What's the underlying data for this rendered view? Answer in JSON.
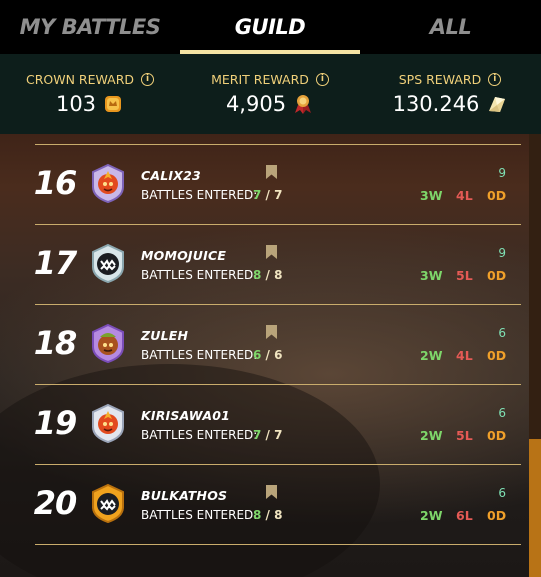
{
  "tabs": [
    {
      "label": "MY BATTLES",
      "active": false
    },
    {
      "label": "GUILD",
      "active": true
    },
    {
      "label": "ALL",
      "active": false
    }
  ],
  "rewards": [
    {
      "label": "CROWN REWARD",
      "value": "103",
      "icon": "crown-token-icon",
      "info_icon": "info-icon"
    },
    {
      "label": "MERIT REWARD",
      "value": "4,905",
      "icon": "merit-badge-icon",
      "info_icon": "info-icon"
    },
    {
      "label": "SPS REWARD",
      "value": "130.246",
      "icon": "sps-crystal-icon",
      "info_icon": "info-icon"
    }
  ],
  "colors": {
    "accent_gold": "#f0d07a",
    "tab_underline": "#f5e3a4",
    "wins": "#7ed66a",
    "losses": "#e55a55",
    "draws": "#f0a02a",
    "score": "#7fe0b4",
    "scrollbar_thumb": "#b87316"
  },
  "battles_entered_label": "BATTLES ENTERED:",
  "players": [
    {
      "rank": "16",
      "name": "CALIX23",
      "entered": "7",
      "total": "7",
      "score": "9",
      "wins": "3W",
      "losses": "4L",
      "draws": "0D",
      "avatar": "fire-league-avatar-icon"
    },
    {
      "rank": "17",
      "name": "MOMOJUICE",
      "entered": "8",
      "total": "8",
      "score": "9",
      "wins": "3W",
      "losses": "5L",
      "draws": "0D",
      "avatar": "silver-monster-avatar-icon"
    },
    {
      "rank": "18",
      "name": "ZULEH",
      "entered": "6",
      "total": "6",
      "score": "6",
      "wins": "2W",
      "losses": "4L",
      "draws": "0D",
      "avatar": "goblin-avatar-icon"
    },
    {
      "rank": "19",
      "name": "KIRISAWA01",
      "entered": "7",
      "total": "7",
      "score": "6",
      "wins": "2W",
      "losses": "5L",
      "draws": "0D",
      "avatar": "fire-league-avatar-icon"
    },
    {
      "rank": "20",
      "name": "BULKATHOS",
      "entered": "8",
      "total": "8",
      "score": "6",
      "wins": "2W",
      "losses": "6L",
      "draws": "0D",
      "avatar": "gold-monster-avatar-icon"
    }
  ]
}
